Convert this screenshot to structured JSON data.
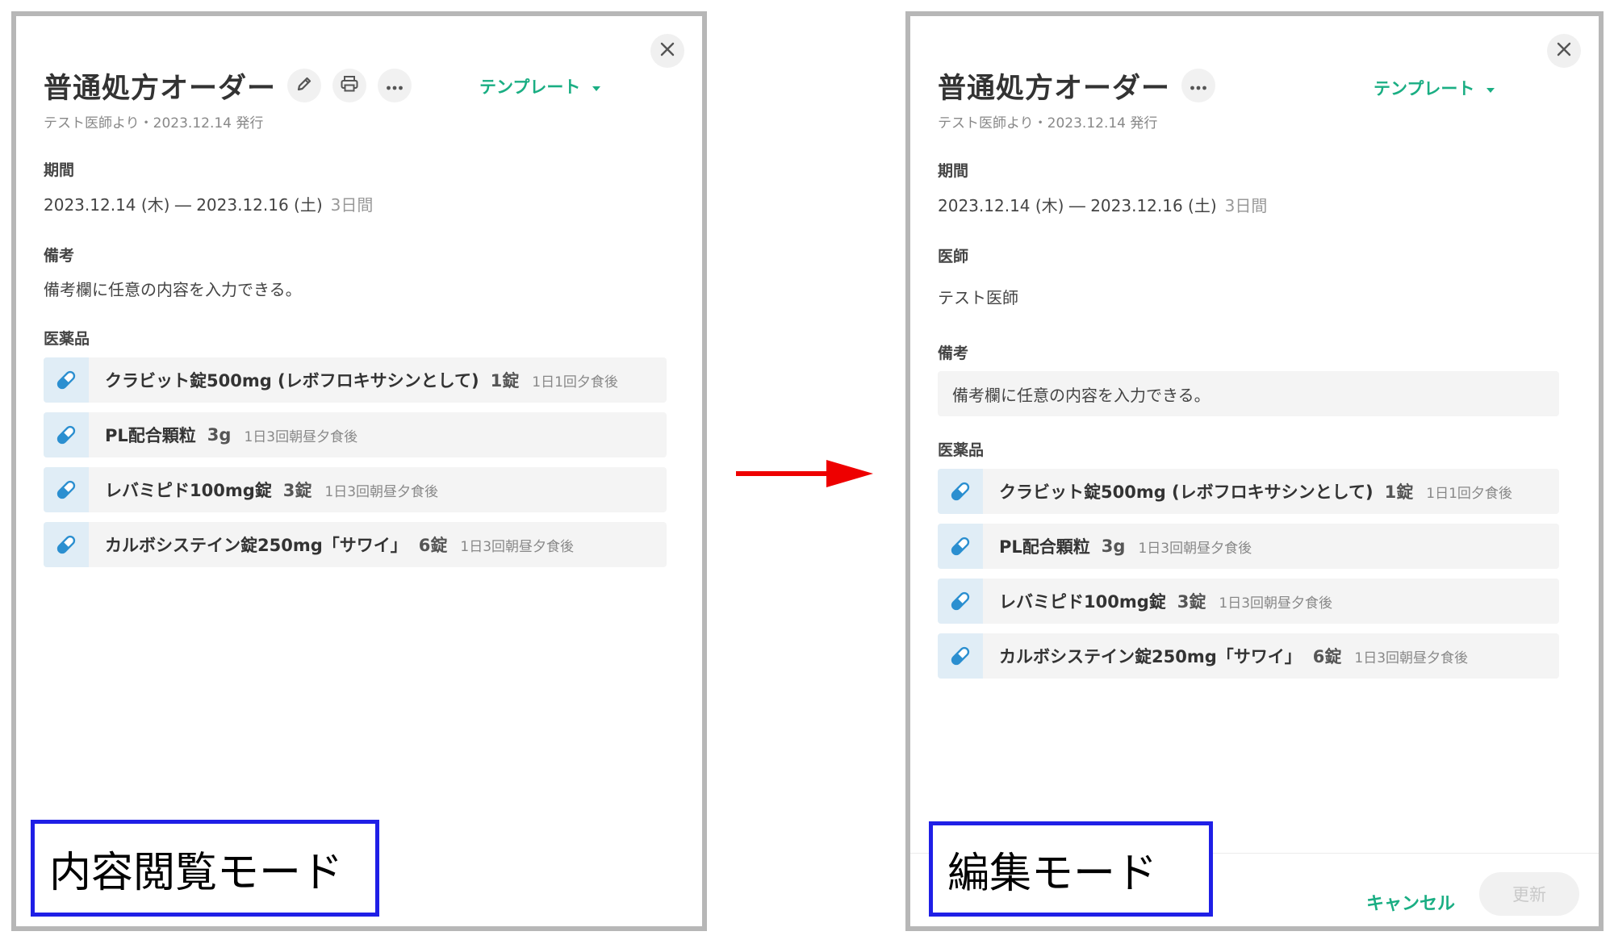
{
  "colors": {
    "accent": "#1aae83",
    "arrow": "#ee0000",
    "mode_border": "#1f1fe6"
  },
  "view_panel": {
    "title": "普通処方オーダー",
    "subtitle": "テスト医師より・2023.12.14 発行",
    "template_label": "テンプレート",
    "period_label": "期間",
    "period_value": "2023.12.14 (木) ― 2023.12.16 (土)",
    "period_days": "3日間",
    "note_label": "備考",
    "note_value": "備考欄に任意の内容を入力できる。",
    "meds_label": "医薬品",
    "mode_caption": "内容閲覧モード",
    "icons": [
      "close-icon",
      "pencil-icon",
      "printer-icon",
      "more-icon",
      "caret-down-icon",
      "pill-icon"
    ]
  },
  "edit_panel": {
    "title": "普通処方オーダー",
    "subtitle": "テスト医師より・2023.12.14 発行",
    "template_label": "テンプレート",
    "period_label": "期間",
    "period_value": "2023.12.14 (木) ― 2023.12.16 (土)",
    "period_days": "3日間",
    "doctor_label": "医師",
    "doctor_value": "テスト医師",
    "note_label": "備考",
    "note_value": "備考欄に任意の内容を入力できる。",
    "meds_label": "医薬品",
    "cancel_label": "キャンセル",
    "update_label": "更新",
    "mode_caption": "編集モード"
  },
  "medications": [
    {
      "name": "クラビット錠500mg (レボフロキサシンとして)",
      "qty": "1錠",
      "usage": "1日1回夕食後"
    },
    {
      "name": "PL配合顆粒",
      "qty": "3g",
      "usage": "1日3回朝昼夕食後"
    },
    {
      "name": "レバミピド100mg錠",
      "qty": "3錠",
      "usage": "1日3回朝昼夕食後"
    },
    {
      "name": "カルボシステイン錠250mg「サワイ」",
      "qty": "6錠",
      "usage": "1日3回朝昼夕食後"
    }
  ]
}
